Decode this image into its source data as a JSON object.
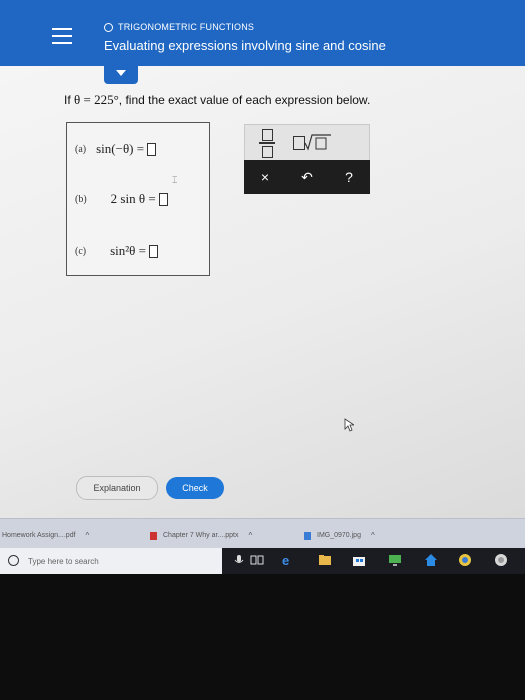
{
  "header": {
    "topic": "TRIGONOMETRIC FUNCTIONS",
    "title": "Evaluating expressions involving sine and cosine"
  },
  "problem": {
    "prompt_lead": "If",
    "prompt_math": "θ = 225°",
    "prompt_tail": ", find the exact value of each expression below."
  },
  "answers": [
    {
      "part": "(a)",
      "expression": "sin(−θ) ="
    },
    {
      "part": "(b)",
      "expression": "2 sin θ ="
    },
    {
      "part": "(c)",
      "expression": "sin²θ ="
    }
  ],
  "keypad": {
    "sqrt_symbol": "√",
    "clear_key": "×",
    "undo_key": "↶",
    "help_key": "?"
  },
  "actions": {
    "explanation_label": "Explanation",
    "check_label": "Check"
  },
  "downloads": [
    {
      "name": "Homework Assign....pdf",
      "caret": "^"
    },
    {
      "name": "Chapter 7 Why ar....pptx",
      "caret": "^"
    },
    {
      "name": "IMG_0970.jpg",
      "caret": "^"
    }
  ],
  "taskbar": {
    "search_placeholder": "Type here to search"
  },
  "colors": {
    "header_blue": "#1f67c2",
    "check_blue": "#1f78d8",
    "keypad_dark": "#1e1e1e",
    "taskbar": "#1a1c22"
  }
}
